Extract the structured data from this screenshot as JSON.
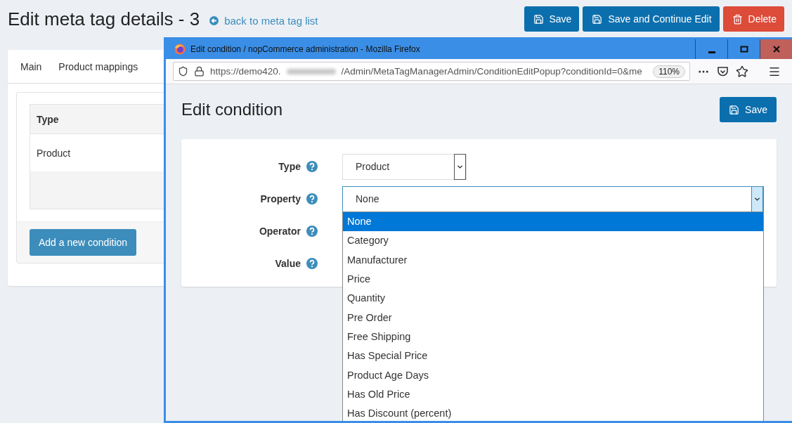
{
  "page": {
    "title": "Edit meta tag details - 3",
    "back_link": "back to meta tag list"
  },
  "actions": [
    {
      "label": "Save",
      "kind": "save"
    },
    {
      "label": "Save and Continue Edit",
      "kind": "save"
    },
    {
      "label": "Delete",
      "kind": "delete"
    }
  ],
  "tabs": [
    {
      "label": "Main"
    },
    {
      "label": "Product mappings"
    }
  ],
  "conditions_table": {
    "columns": [
      "Type"
    ],
    "rows": [
      [
        "Product"
      ]
    ]
  },
  "add_button": "Add a new condition",
  "popup": {
    "window_title": "Edit condition / nopCommerce administration - Mozilla Firefox",
    "url_start": "https://demo420.",
    "url_end": "/Admin/MetaTagManagerAdmin/ConditionEditPopup?conditionId=0&me",
    "zoom": "110%",
    "heading": "Edit condition",
    "save": "Save",
    "fields": [
      {
        "label": "Type",
        "value": "Product",
        "expanded": false
      },
      {
        "label": "Property",
        "value": "None",
        "expanded": true,
        "options": [
          {
            "label": "None",
            "selected": true
          },
          {
            "label": "Category",
            "selected": false
          },
          {
            "label": "Manufacturer",
            "selected": false
          },
          {
            "label": "Price",
            "selected": false
          },
          {
            "label": "Quantity",
            "selected": false
          },
          {
            "label": "Pre Order",
            "selected": false
          },
          {
            "label": "Free Shipping",
            "selected": false
          },
          {
            "label": "Has Special Price",
            "selected": false
          },
          {
            "label": "Product Age Days",
            "selected": false
          },
          {
            "label": "Has Old Price",
            "selected": false
          },
          {
            "label": "Has Discount (percent)",
            "selected": false
          }
        ]
      },
      {
        "label": "Operator"
      },
      {
        "label": "Value"
      }
    ]
  }
}
